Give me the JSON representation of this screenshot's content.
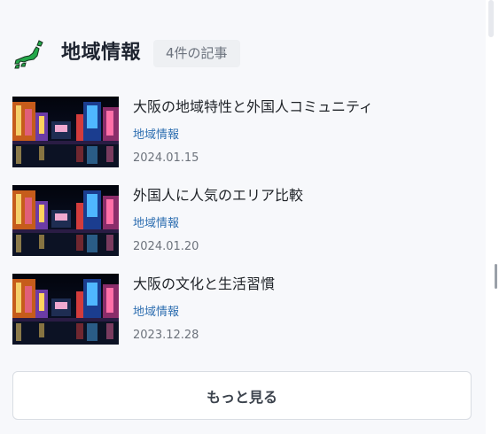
{
  "section": {
    "title": "地域情報",
    "count_badge": "4件の記事",
    "icon": "japan-map-icon"
  },
  "articles": [
    {
      "title": "大阪の地域特性と外国人コミュニティ",
      "category": "地域情報",
      "date": "2024.01.15",
      "thumbnail": "osaka-dotonbori-night"
    },
    {
      "title": "外国人に人気のエリア比較",
      "category": "地域情報",
      "date": "2024.01.20",
      "thumbnail": "osaka-dotonbori-night"
    },
    {
      "title": "大阪の文化と生活習慣",
      "category": "地域情報",
      "date": "2023.12.28",
      "thumbnail": "osaka-dotonbori-night"
    }
  ],
  "more_button": {
    "label": "もっと見る"
  },
  "colors": {
    "background": "#f7f8fb",
    "category_link": "#2f6fb1",
    "japan_icon": "#24a84a",
    "badge_bg": "#eef0f3"
  }
}
